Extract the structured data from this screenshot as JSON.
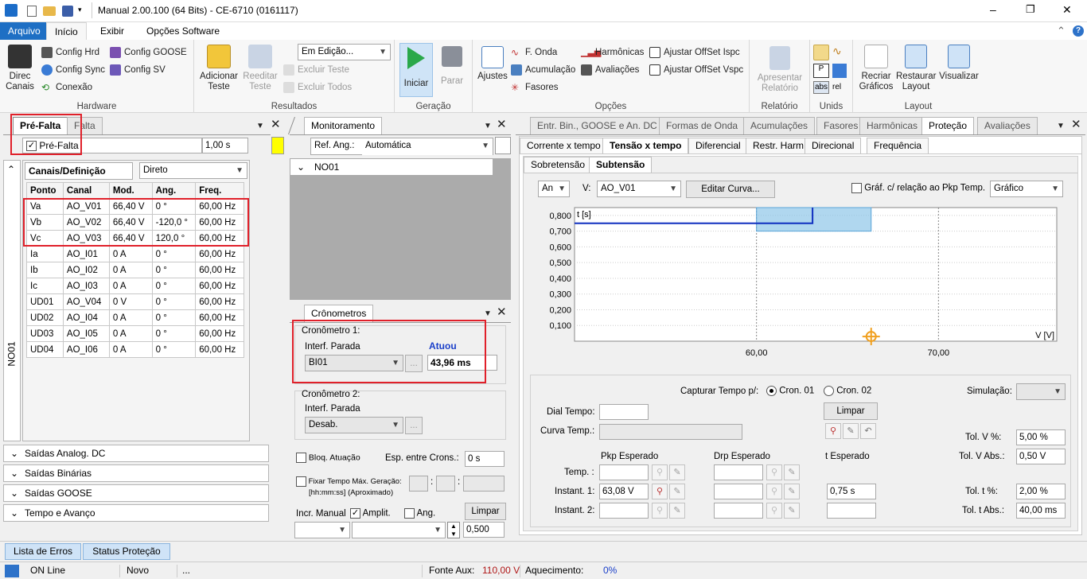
{
  "window": {
    "title": "Manual 2.00.100 (64 Bits) - CE-6710 (0161117)",
    "min": "–",
    "max": "❐",
    "close": "✕"
  },
  "menu": {
    "arquivo": "Arquivo",
    "inicio": "Início",
    "exibir": "Exibir",
    "opcoes": "Opções Software",
    "up": "⌃",
    "help": "?"
  },
  "ribbon": {
    "hardware": {
      "label": "Hardware",
      "direc": "Direc Canais",
      "config_hrd": "Config Hrd",
      "config_sync": "Config Sync",
      "conexao": "Conexão",
      "config_goose": "Config GOOSE",
      "config_sv": "Config SV"
    },
    "resultados": {
      "label": "Resultados",
      "adicionar": "Adicionar Teste",
      "reeditar": "Reeditar Teste",
      "em_edicao": "Em Edição...",
      "excluir_teste": "Excluir Teste",
      "excluir_todos": "Excluir Todos"
    },
    "geracao": {
      "label": "Geração",
      "iniciar": "Iniciar",
      "parar": "Parar"
    },
    "opcoes": {
      "label": "Opções",
      "ajustes": "Ajustes",
      "f_onda": "F. Onda",
      "acumulacao": "Acumulação",
      "fasores": "Fasores",
      "harmonicas": "Harmônicas",
      "avaliacoes": "Avaliações",
      "offset_ispc": "Ajustar OffSet Ispc",
      "offset_vspc": "Ajustar OffSet Vspc"
    },
    "relatorio": {
      "label": "Relatório",
      "apresentar": "Apresentar Relatório"
    },
    "unids": {
      "label": "Unids",
      "abs": "abs",
      "rel": "rel"
    },
    "layout": {
      "label": "Layout",
      "recriar": "Recriar Gráficos",
      "restaurar": "Restaurar Layout",
      "visualizar": "Visualizar"
    }
  },
  "left": {
    "tab_prefalta": "Pré-Falta",
    "tab_falta": "Falta",
    "chk_prefalta": "Pré-Falta",
    "prefalta_time": "1,00 s",
    "side_label": "NO01",
    "tab_canais": "Canais/Definição",
    "modo": "Direto",
    "headers": [
      "Ponto",
      "Canal",
      "Mod.",
      "Ang.",
      "Freq."
    ],
    "rows": [
      [
        "Va",
        "AO_V01",
        "66,40 V",
        "0 °",
        "60,00 Hz"
      ],
      [
        "Vb",
        "AO_V02",
        "66,40 V",
        "-120,0 °",
        "60,00 Hz"
      ],
      [
        "Vc",
        "AO_V03",
        "66,40 V",
        "120,0 °",
        "60,00 Hz"
      ],
      [
        "Ia",
        "AO_I01",
        "0 A",
        "0 °",
        "60,00 Hz"
      ],
      [
        "Ib",
        "AO_I02",
        "0 A",
        "0 °",
        "60,00 Hz"
      ],
      [
        "Ic",
        "AO_I03",
        "0 A",
        "0 °",
        "60,00 Hz"
      ],
      [
        "UD01",
        "AO_V04",
        "0 V",
        "0 °",
        "60,00 Hz"
      ],
      [
        "UD02",
        "AO_I04",
        "0 A",
        "0 °",
        "60,00 Hz"
      ],
      [
        "UD03",
        "AO_I05",
        "0 A",
        "0 °",
        "60,00 Hz"
      ],
      [
        "UD04",
        "AO_I06",
        "0 A",
        "0 °",
        "60,00 Hz"
      ]
    ],
    "sections": [
      "Saídas Analog. DC",
      "Saídas Binárias",
      "Saídas GOOSE",
      "Tempo e Avanço"
    ]
  },
  "mid": {
    "tab_monitor": "Monitoramento",
    "ref_ang_label": "Ref. Ang.:",
    "ref_ang_value": "Automática",
    "node": "NO01",
    "tab_crono": "Crônometros",
    "crono1": {
      "title": "Cronômetro 1:",
      "interf": "Interf. Parada",
      "value": "BI01",
      "atuou": "Atuou",
      "time": "43,96 ms"
    },
    "crono2": {
      "title": "Cronômetro 2:",
      "interf": "Interf. Parada",
      "value": "Desab."
    },
    "bloq": "Bloq. Atuação",
    "esp": "Esp. entre Crons.:",
    "esp_value": "0 s",
    "fixar": "Fixar Tempo Máx. Geração:",
    "fixar2": "[hh:mm:ss] (Aproximado)",
    "incr": "Incr. Manual",
    "amplit": "Amplit.",
    "ang": "Ang.",
    "limpar": "Limpar",
    "step": "0,500"
  },
  "right": {
    "tabs": [
      "Entr. Bin., GOOSE e An. DC",
      "Formas de Onda",
      "Acumulações",
      "Fasores",
      "Harmônicas",
      "Proteção",
      "Avaliações"
    ],
    "subtabs": [
      "Corrente x tempo",
      "Tensão x tempo",
      "Diferencial",
      "Restr. Harm.",
      "Direcional",
      "Frequência"
    ],
    "subsub": [
      "Sobretensão",
      "Subtensão"
    ],
    "an": "An",
    "v_label": "V:",
    "v_value": "AO_V01",
    "editar": "Editar Curva...",
    "graf_rel": "Gráf. c/ relação ao Pkp Temp.",
    "grafico": "Gráfico",
    "capturar": "Capturar Tempo p/:",
    "cron01": "Cron. 01",
    "cron02": "Cron. 02",
    "simulacao": "Simulação:",
    "dial": "Dial Tempo:",
    "curva": "Curva Temp.:",
    "limpar": "Limpar",
    "pkp": "Pkp Esperado",
    "drp": "Drp Esperado",
    "t_esp": "t Esperado",
    "temp": "Temp. :",
    "inst1": "Instant. 1:",
    "inst2": "Instant. 2:",
    "inst1_pkp": "63,08 V",
    "inst1_t": "0,75 s",
    "tol_v_pct": "Tol. V %:",
    "tol_v_pct_val": "5,00 %",
    "tol_v_abs": "Tol. V Abs.:",
    "tol_v_abs_val": "0,50 V",
    "tol_t_pct": "Tol. t %:",
    "tol_t_pct_val": "2,00 %",
    "tol_t_abs": "Tol. t Abs.:",
    "tol_t_abs_val": "40,00 ms"
  },
  "bottom_tabs": {
    "erros": "Lista de Erros",
    "status": "Status Proteção"
  },
  "statusbar": {
    "online": "ON Line",
    "novo": "Novo",
    "dots": "...",
    "fonte": "Fonte Aux:",
    "fonte_val": "110,00 V",
    "aquec": "Aquecimento:",
    "aquec_val": "0%"
  },
  "chart_data": {
    "type": "line",
    "ylabel": "t [s]",
    "xlabel": "V [V]",
    "yticks": [
      "0,800",
      "0,700",
      "0,600",
      "0,500",
      "0,400",
      "0,300",
      "0,200",
      "0,100"
    ],
    "xticks": [
      "60,00",
      "70,00"
    ],
    "xlim": [
      50.0,
      76.5
    ],
    "ylim": [
      0,
      0.85
    ],
    "series": [
      {
        "x": [
          50.0,
          63.08,
          63.08
        ],
        "y": [
          0.75,
          0.75,
          0.85
        ]
      }
    ],
    "tolerance_band": {
      "x": [
        60.0,
        66.3
      ],
      "y": [
        0.7,
        0.85
      ]
    },
    "marker": {
      "x": 66.3,
      "y": 0.03
    },
    "accent": "#1030c0",
    "band_color": "#8fc6e8"
  }
}
